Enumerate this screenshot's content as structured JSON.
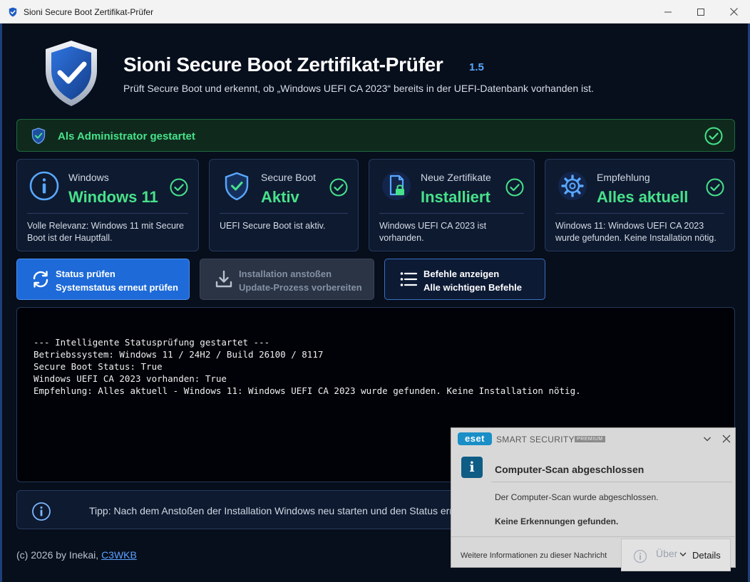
{
  "window": {
    "title": "Sioni Secure Boot Zertifikat-Prüfer"
  },
  "header": {
    "title": "Sioni Secure Boot Zertifikat-Prüfer",
    "version": "1.5",
    "subtitle": "Prüft Secure Boot und erkennt, ob „Windows UEFI CA 2023“ bereits in der UEFI-Datenbank vorhanden ist."
  },
  "admin_banner": {
    "text": "Als Administrator gestartet"
  },
  "cards": [
    {
      "icon": "info-icon",
      "label": "Windows",
      "value": "Windows 11",
      "description": "Volle Relevanz: Windows 11 mit Secure Boot ist der Hauptfall."
    },
    {
      "icon": "shield-icon",
      "label": "Secure Boot",
      "value": "Aktiv",
      "description": "UEFI Secure Boot ist aktiv."
    },
    {
      "icon": "certificate-lock-icon",
      "label": "Neue Zertifikate",
      "value": "Installiert",
      "description": "Windows UEFI CA 2023 ist vorhanden."
    },
    {
      "icon": "gear-icon",
      "label": "Empfehlung",
      "value": "Alles aktuell",
      "description": "Windows 11: Windows UEFI CA 2023 wurde gefunden. Keine Installation nötig."
    }
  ],
  "actions": {
    "check": {
      "title": "Status prüfen",
      "subtitle": "Systemstatus erneut prüfen"
    },
    "install": {
      "title": "Installation anstoßen",
      "subtitle": "Update-Prozess vorbereiten"
    },
    "commands": {
      "title": "Befehle anzeigen",
      "subtitle": "Alle wichtigen Befehle"
    }
  },
  "console": {
    "lines": [
      "--- Intelligente Statusprüfung gestartet ---",
      "Betriebssystem: Windows 11 / 24H2 / Build 26100 / 8117",
      "Secure Boot Status: True",
      "Windows UEFI CA 2023 vorhanden: True",
      "Empfehlung: Alles aktuell - Windows 11: Windows UEFI CA 2023 wurde gefunden. Keine Installation nötig."
    ]
  },
  "tip": {
    "text": "Tipp: Nach dem Anstoßen der Installation Windows neu starten und den Status erneut prüfen."
  },
  "footer": {
    "copyright": "(c) 2026 by Inekai,",
    "link": "C3WKB"
  },
  "toast": {
    "logo": "eset",
    "brand": "SMART SECURITY",
    "badge": "PREMIUM",
    "heading": "Computer-Scan abgeschlossen",
    "body": "Der Computer-Scan wurde abgeschlossen.",
    "result": "Keine Erkennungen gefunden.",
    "more_info": "Weitere Informationen zu dieser Nachricht",
    "details": "Details",
    "ghost_label": "Über"
  },
  "colors": {
    "success": "#47e28a",
    "accent": "#1d6ad8",
    "background": "#070e1c",
    "card": "#0e1a30",
    "link": "#5aa2ff"
  }
}
